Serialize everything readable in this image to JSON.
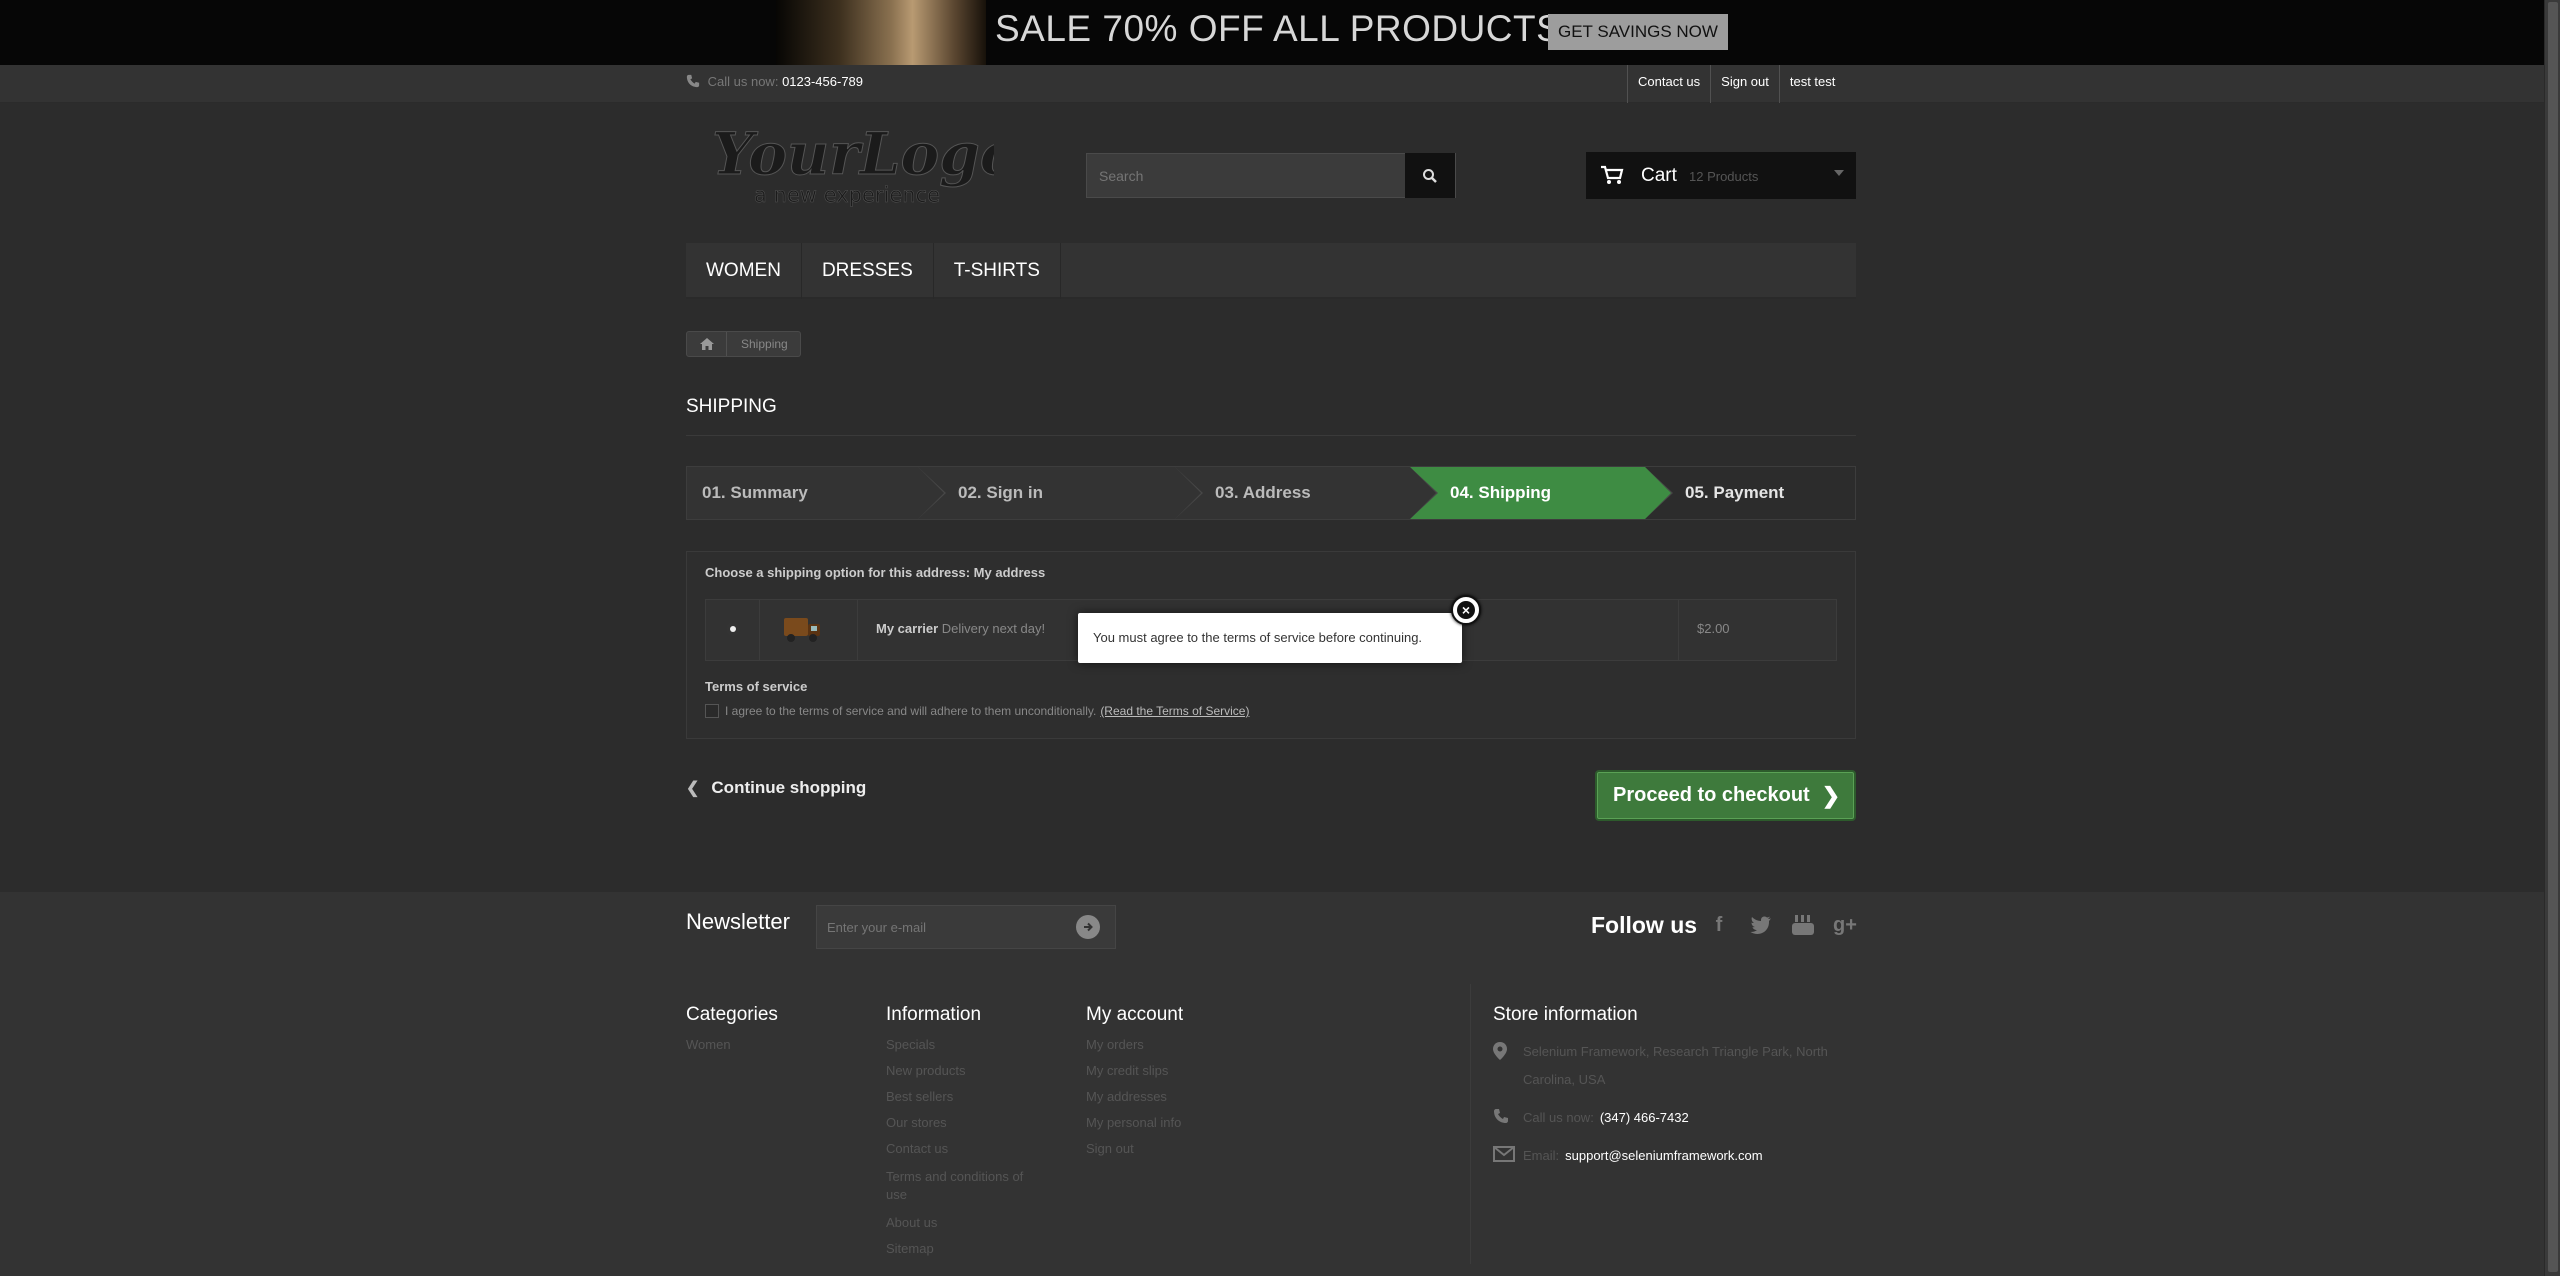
{
  "banner": {
    "headline": "SALE 70% OFF ALL PRODUCTS",
    "cta": "GET SAVINGS NOW"
  },
  "topnav": {
    "call_label": "Call us now:",
    "phone": "0123-456-789",
    "links": [
      "Contact us",
      "Sign out",
      "test test"
    ]
  },
  "header": {
    "logo_main": "YourLogo",
    "logo_sub": "a new experience",
    "search_placeholder": "Search",
    "cart_label": "Cart",
    "cart_count": "12 Products"
  },
  "menu": [
    "WOMEN",
    "DRESSES",
    "T-SHIRTS"
  ],
  "breadcrumb": {
    "current": "Shipping"
  },
  "page_heading": "SHIPPING",
  "steps": [
    "01. Summary",
    "02. Sign in",
    "03. Address",
    "04. Shipping",
    "05. Payment"
  ],
  "shipping": {
    "choose_label": "Choose a shipping option for this address: My address",
    "carrier_name": "My carrier",
    "carrier_delay": "Delivery next day!",
    "carrier_price": "$2.00",
    "tos_title": "Terms of service",
    "tos_text": "I agree to the terms of service and will adhere to them unconditionally.",
    "tos_link": "(Read the Terms of Service)"
  },
  "actions": {
    "continue": "Continue shopping",
    "proceed": "Proceed to checkout"
  },
  "modal": {
    "message": "You must agree to the terms of service before continuing."
  },
  "newsletter": {
    "title": "Newsletter",
    "placeholder": "Enter your e-mail",
    "follow": "Follow us"
  },
  "footer": {
    "categories": {
      "title": "Categories",
      "items": [
        "Women"
      ]
    },
    "information": {
      "title": "Information",
      "items": [
        "Specials",
        "New products",
        "Best sellers",
        "Our stores",
        "Contact us",
        "Terms and conditions of use",
        "About us",
        "Sitemap"
      ]
    },
    "account": {
      "title": "My account",
      "items": [
        "My orders",
        "My credit slips",
        "My addresses",
        "My personal info",
        "Sign out"
      ]
    },
    "store": {
      "title": "Store information",
      "address": "Selenium Framework, Research Triangle Park, North Carolina, USA",
      "call_label": "Call us now:",
      "phone": "(347) 466-7432",
      "email_label": "Email:",
      "email": "support@seleniumframework.com"
    }
  }
}
